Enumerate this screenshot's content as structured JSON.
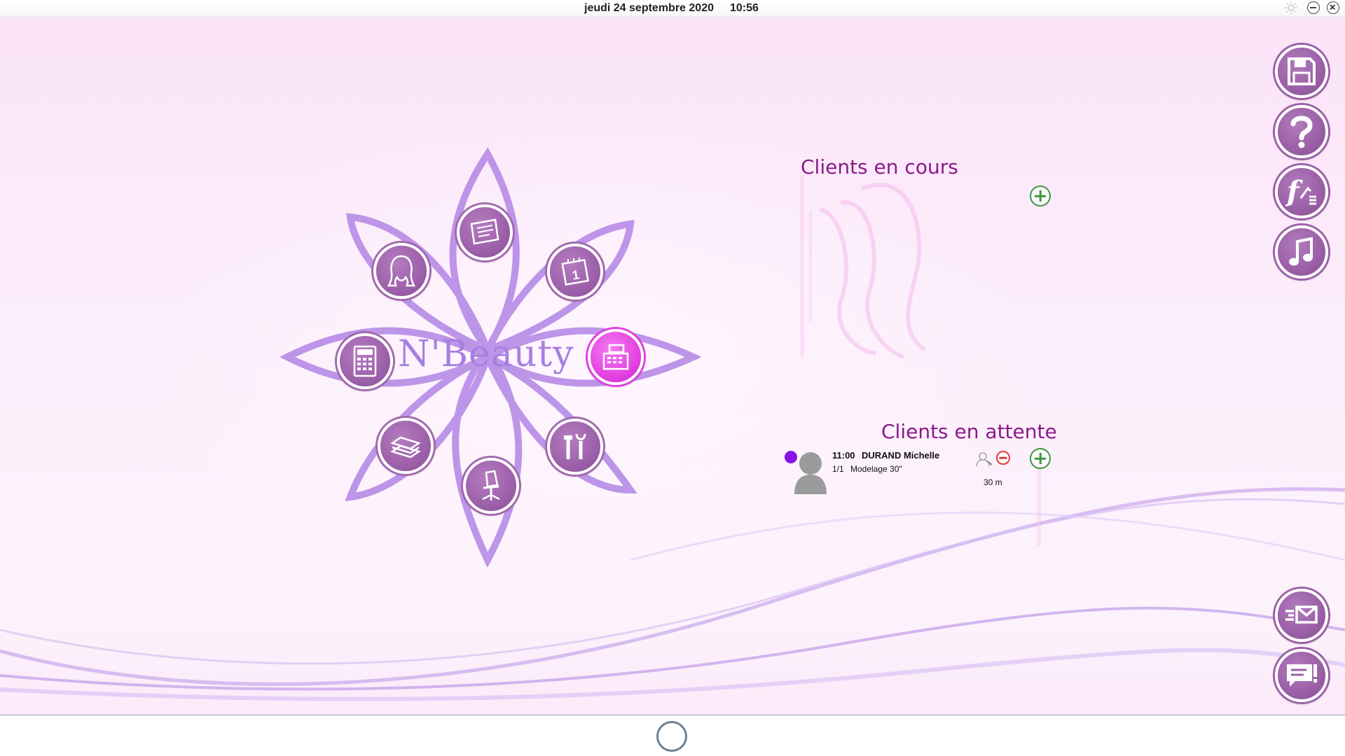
{
  "topbar": {
    "date": "jeudi 24 septembre 2020",
    "time": "10:56",
    "icons": [
      "sun-icon",
      "minimize-icon",
      "close-icon"
    ]
  },
  "logo": {
    "text": "N'Beauty"
  },
  "flower_menu": [
    {
      "name": "hair-button",
      "icon": "woman-head-icon"
    },
    {
      "name": "file-button",
      "icon": "file-folder-icon"
    },
    {
      "name": "calendar-button",
      "icon": "calendar-icon"
    },
    {
      "name": "register-button",
      "icon": "cash-register-icon",
      "active": true
    },
    {
      "name": "tools-button",
      "icon": "tools-icon"
    },
    {
      "name": "chair-button",
      "icon": "office-chair-icon"
    },
    {
      "name": "stock-button",
      "icon": "stack-icon"
    },
    {
      "name": "calculator-button",
      "icon": "calculator-icon"
    }
  ],
  "clients_en_cours": {
    "title": "Clients en cours"
  },
  "clients_en_attente": {
    "title": "Clients en attente",
    "rows": [
      {
        "time": "11:00",
        "name": "DURAND Michelle",
        "count": "1/1",
        "service": "Modelage 30''",
        "duration": "30 m",
        "status_color": "#8a12e6"
      }
    ]
  },
  "side_buttons": [
    {
      "name": "save-button",
      "icon": "floppy-disk-icon"
    },
    {
      "name": "help-button",
      "icon": "question-mark-icon"
    },
    {
      "name": "invoice-button",
      "icon": "f-list-icon"
    },
    {
      "name": "music-button",
      "icon": "music-note-icon"
    },
    {
      "name": "mail-button",
      "icon": "envelope-icon"
    },
    {
      "name": "messages-button",
      "icon": "chat-bubble-icon"
    }
  ],
  "colors": {
    "accent_purple": "#9a5fa6",
    "active_pink": "#e23fe0",
    "title_color": "#8a1a8a",
    "logo_color": "#a77fe0"
  }
}
